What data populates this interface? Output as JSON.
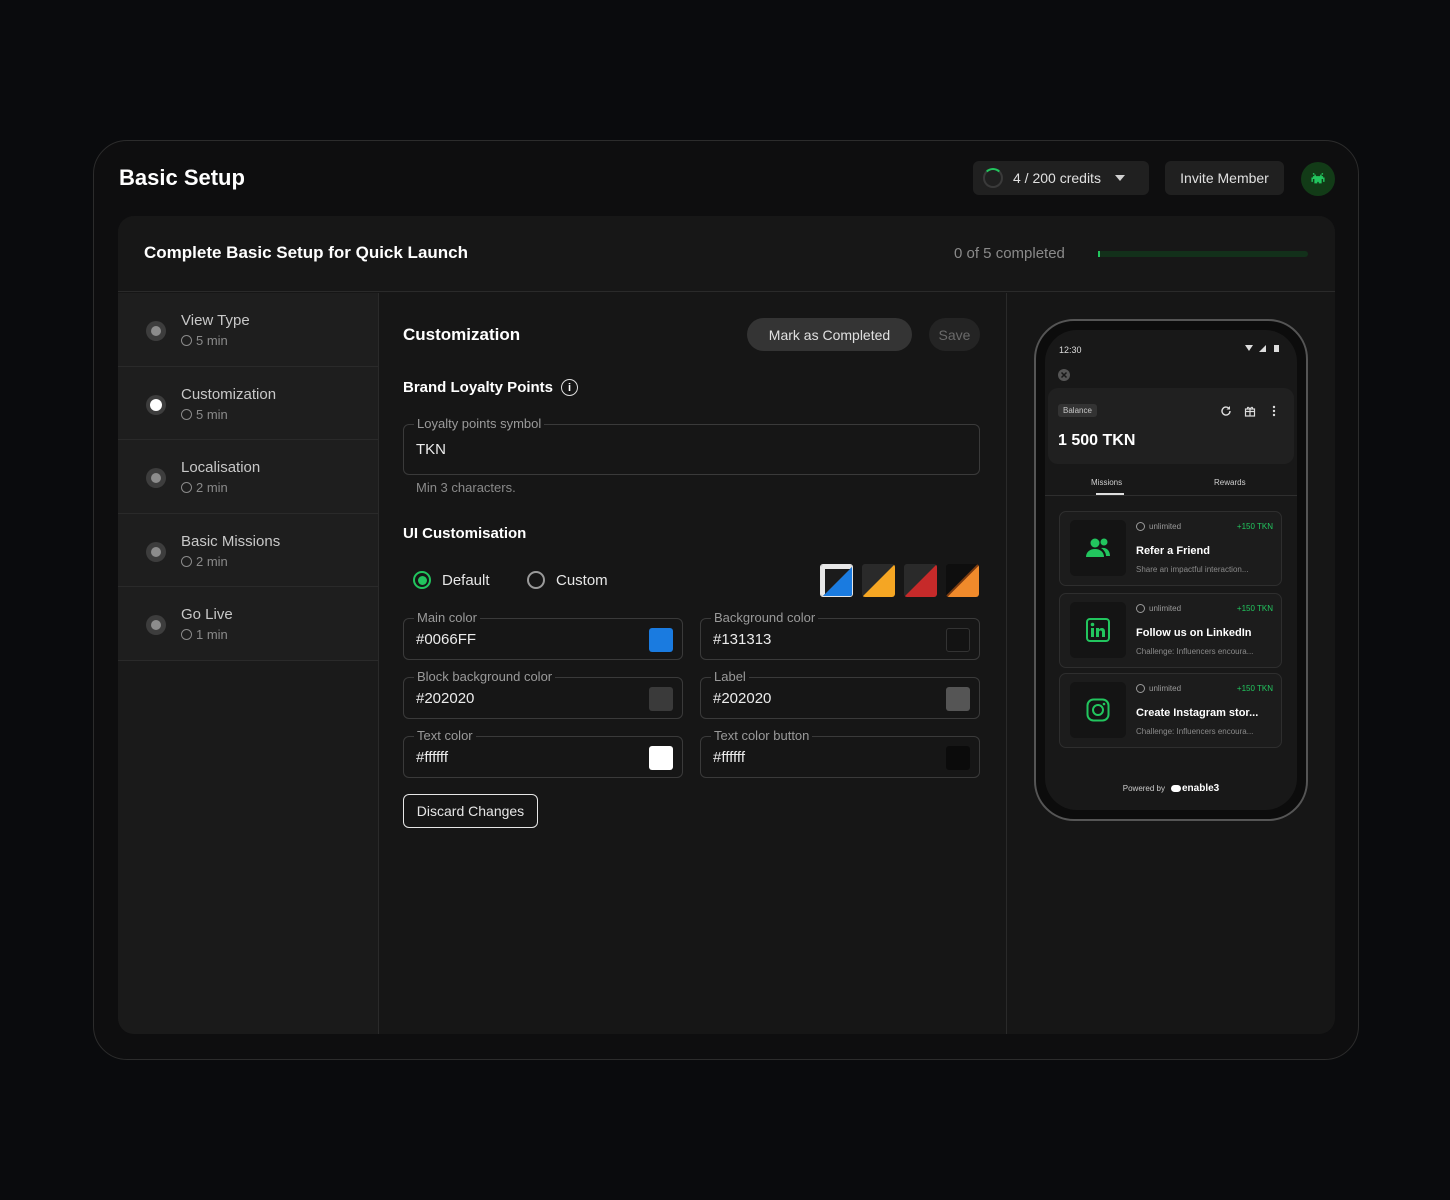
{
  "header": {
    "title": "Basic Setup",
    "credits": "4 / 200 credits",
    "invite": "Invite Member"
  },
  "setup": {
    "title": "Complete Basic Setup for Quick Launch",
    "progress_text": "0 of 5 completed",
    "progress_fraction": 0.0
  },
  "steps": [
    {
      "label": "View Type",
      "time": "5 min"
    },
    {
      "label": "Customization",
      "time": "5 min"
    },
    {
      "label": "Localisation",
      "time": "2 min"
    },
    {
      "label": "Basic Missions",
      "time": "2 min"
    },
    {
      "label": "Go Live",
      "time": "1 min"
    }
  ],
  "main": {
    "title": "Customization",
    "mark_completed": "Mark as Completed",
    "save": "Save",
    "loyalty_title": "Brand Loyalty Points",
    "symbol_label": "Loyalty points symbol",
    "symbol_value": "TKN",
    "symbol_hint": "Min 3 characters.",
    "ui_title": "UI Customisation",
    "radio_default": "Default",
    "radio_custom": "Custom",
    "fields": {
      "main_color": {
        "label": "Main color",
        "value": "#0066FF",
        "swatch": "#1a7be0"
      },
      "bg_color": {
        "label": "Background color",
        "value": "#131313",
        "swatch": "#131313"
      },
      "block_bg": {
        "label": "Block background color",
        "value": "#202020",
        "swatch": "#3a3a3a"
      },
      "label": {
        "label": "Label",
        "value": "#202020",
        "swatch": "#555555"
      },
      "text_color": {
        "label": "Text color",
        "value": "#ffffff",
        "swatch": "#ffffff"
      },
      "text_btn": {
        "label": "Text color button",
        "value": "#ffffff",
        "swatch": "#0b0b0b"
      }
    },
    "discard": "Discard Changes"
  },
  "phone": {
    "time": "12:30",
    "balance_chip": "Balance",
    "balance": "1 500 TKN",
    "tabs": [
      "Missions",
      "Rewards"
    ],
    "missions": [
      {
        "limit": "unlimited",
        "reward": "+150 TKN",
        "title": "Refer a Friend",
        "desc": "Share an impactful interaction...",
        "icon": "users-icon"
      },
      {
        "limit": "unlimited",
        "reward": "+150 TKN",
        "title": "Follow us on LinkedIn",
        "desc": "Challenge: Influencers encoura...",
        "icon": "linkedin-icon"
      },
      {
        "limit": "unlimited",
        "reward": "+150 TKN",
        "title": "Create Instagram stor...",
        "desc": "Challenge: Influencers encoura...",
        "icon": "instagram-icon"
      }
    ],
    "powered": "Powered by",
    "brand": "enable3"
  },
  "colors": {
    "accent": "#22c55e",
    "primary_blue": "#0066FF"
  }
}
